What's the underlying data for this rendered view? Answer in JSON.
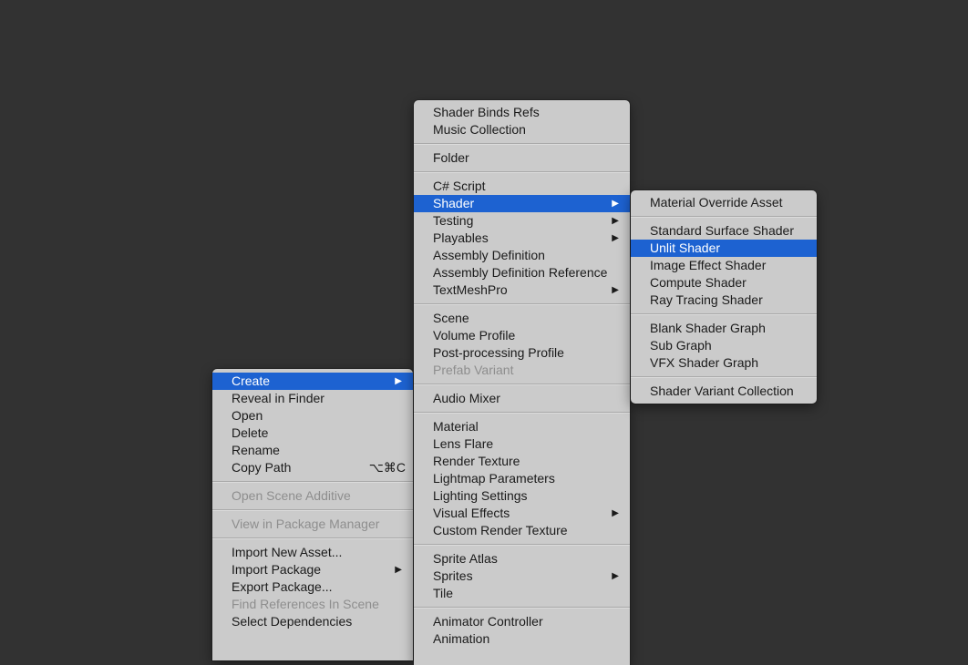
{
  "context_menu": {
    "items": [
      {
        "type": "item",
        "label": "Create",
        "submenu": true,
        "selected": true
      },
      {
        "type": "item",
        "label": "Reveal in Finder"
      },
      {
        "type": "item",
        "label": "Open"
      },
      {
        "type": "item",
        "label": "Delete"
      },
      {
        "type": "item",
        "label": "Rename"
      },
      {
        "type": "item",
        "label": "Copy Path",
        "shortcut": "⌥⌘C"
      },
      {
        "type": "sep"
      },
      {
        "type": "item",
        "label": "Open Scene Additive",
        "disabled": true
      },
      {
        "type": "sep"
      },
      {
        "type": "item",
        "label": "View in Package Manager",
        "disabled": true
      },
      {
        "type": "sep"
      },
      {
        "type": "item",
        "label": "Import New Asset..."
      },
      {
        "type": "item",
        "label": "Import Package",
        "submenu": true
      },
      {
        "type": "item",
        "label": "Export Package..."
      },
      {
        "type": "item",
        "label": "Find References In Scene",
        "disabled": true
      },
      {
        "type": "item",
        "label": "Select Dependencies"
      }
    ]
  },
  "create_menu": {
    "items": [
      {
        "type": "item",
        "label": "Shader Binds Refs"
      },
      {
        "type": "item",
        "label": "Music Collection"
      },
      {
        "type": "sep"
      },
      {
        "type": "item",
        "label": "Folder"
      },
      {
        "type": "sep"
      },
      {
        "type": "item",
        "label": "C# Script"
      },
      {
        "type": "item",
        "label": "Shader",
        "submenu": true,
        "selected": true
      },
      {
        "type": "item",
        "label": "Testing",
        "submenu": true
      },
      {
        "type": "item",
        "label": "Playables",
        "submenu": true
      },
      {
        "type": "item",
        "label": "Assembly Definition"
      },
      {
        "type": "item",
        "label": "Assembly Definition Reference"
      },
      {
        "type": "item",
        "label": "TextMeshPro",
        "submenu": true
      },
      {
        "type": "sep"
      },
      {
        "type": "item",
        "label": "Scene"
      },
      {
        "type": "item",
        "label": "Volume Profile"
      },
      {
        "type": "item",
        "label": "Post-processing Profile"
      },
      {
        "type": "item",
        "label": "Prefab Variant",
        "disabled": true
      },
      {
        "type": "sep"
      },
      {
        "type": "item",
        "label": "Audio Mixer"
      },
      {
        "type": "sep"
      },
      {
        "type": "item",
        "label": "Material"
      },
      {
        "type": "item",
        "label": "Lens Flare"
      },
      {
        "type": "item",
        "label": "Render Texture"
      },
      {
        "type": "item",
        "label": "Lightmap Parameters"
      },
      {
        "type": "item",
        "label": "Lighting Settings"
      },
      {
        "type": "item",
        "label": "Visual Effects",
        "submenu": true
      },
      {
        "type": "item",
        "label": "Custom Render Texture"
      },
      {
        "type": "sep"
      },
      {
        "type": "item",
        "label": "Sprite Atlas"
      },
      {
        "type": "item",
        "label": "Sprites",
        "submenu": true
      },
      {
        "type": "item",
        "label": "Tile"
      },
      {
        "type": "sep"
      },
      {
        "type": "item",
        "label": "Animator Controller"
      },
      {
        "type": "item",
        "label": "Animation"
      }
    ]
  },
  "shader_menu": {
    "items": [
      {
        "type": "item",
        "label": "Material Override Asset"
      },
      {
        "type": "sep"
      },
      {
        "type": "item",
        "label": "Standard Surface Shader"
      },
      {
        "type": "item",
        "label": "Unlit Shader",
        "selected": true
      },
      {
        "type": "item",
        "label": "Image Effect Shader"
      },
      {
        "type": "item",
        "label": "Compute Shader"
      },
      {
        "type": "item",
        "label": "Ray Tracing Shader"
      },
      {
        "type": "sep"
      },
      {
        "type": "item",
        "label": "Blank Shader Graph"
      },
      {
        "type": "item",
        "label": "Sub Graph"
      },
      {
        "type": "item",
        "label": "VFX Shader Graph"
      },
      {
        "type": "sep"
      },
      {
        "type": "item",
        "label": "Shader Variant Collection"
      }
    ]
  },
  "icons": {
    "submenu_arrow": "▶"
  },
  "colors": {
    "background": "#323232",
    "menu": "#cbcbcb",
    "highlight": "#1d62d1"
  }
}
